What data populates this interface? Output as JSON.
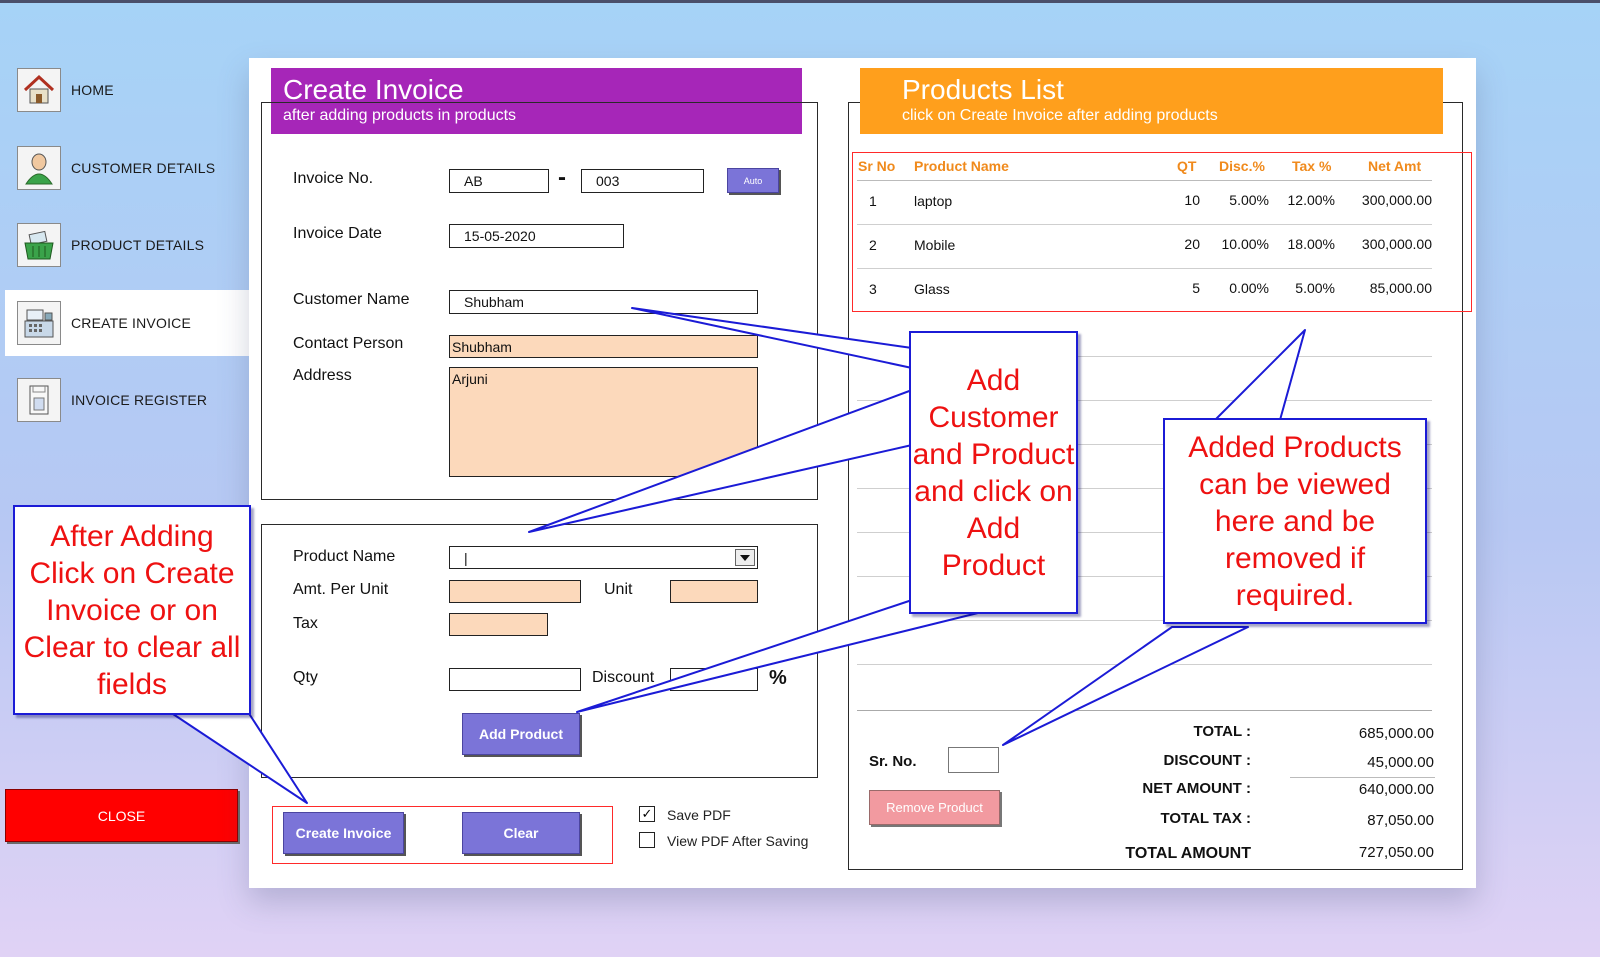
{
  "sidebar": {
    "items": [
      {
        "label": "HOME",
        "icon": "home-icon"
      },
      {
        "label": "CUSTOMER DETAILS",
        "icon": "customer-icon"
      },
      {
        "label": "PRODUCT DETAILS",
        "icon": "basket-icon"
      },
      {
        "label": "CREATE INVOICE",
        "icon": "cash-register-icon",
        "active": true
      },
      {
        "label": "INVOICE REGISTER",
        "icon": "register-icon"
      }
    ],
    "close_label": "CLOSE"
  },
  "invoice": {
    "title": "Create Invoice",
    "subtitle": "after adding products in products",
    "invoice_no_label": "Invoice No.",
    "invoice_prefix": "AB",
    "invoice_separator": "-",
    "invoice_number": "003",
    "auto_label": "Auto",
    "invoice_date_label": "Invoice Date",
    "invoice_date": "15-05-2020",
    "customer_name_label": "Customer Name",
    "customer_name": "Shubham",
    "contact_person_label": "Contact Person",
    "contact_person": "Shubham",
    "address_label": "Address",
    "address": "Arjuni"
  },
  "product_form": {
    "product_name_label": "Product Name",
    "product_name": "|",
    "amt_per_unit_label": "Amt. Per Unit",
    "unit_label": "Unit",
    "tax_label": "Tax",
    "qty_label": "Qty",
    "discount_label": "Discount",
    "percent_sign": "%",
    "add_product_label": "Add Product"
  },
  "actions": {
    "create_invoice_label": "Create Invoice",
    "clear_label": "Clear",
    "save_pdf_label": "Save PDF",
    "save_pdf_checked": true,
    "view_pdf_label": "View PDF After Saving",
    "view_pdf_checked": false,
    "save_pdf_mark": "✓"
  },
  "products": {
    "title": "Products List",
    "subtitle": "click on Create Invoice after adding products",
    "columns": [
      "Sr No",
      "Product Name",
      "QT",
      "Disc.%",
      "Tax %",
      "Net Amt"
    ],
    "rows": [
      {
        "sr": "1",
        "name": "laptop",
        "qt": "10",
        "disc": "5.00%",
        "tax": "12.00%",
        "net": "300,000.00"
      },
      {
        "sr": "2",
        "name": "Mobile",
        "qt": "20",
        "disc": "10.00%",
        "tax": "18.00%",
        "net": "300,000.00"
      },
      {
        "sr": "3",
        "name": "Glass",
        "qt": "5",
        "disc": "0.00%",
        "tax": "5.00%",
        "net": "85,000.00"
      }
    ],
    "sr_no_label": "Sr. No.",
    "remove_label": "Remove Product"
  },
  "totals": {
    "total_label": "TOTAL :",
    "total": "685,000.00",
    "discount_label": "DISCOUNT :",
    "discount": "45,000.00",
    "net_amount_label": "NET AMOUNT :",
    "net_amount": "640,000.00",
    "total_tax_label": "TOTAL TAX :",
    "total_tax": "87,050.00",
    "total_amount_label": "TOTAL AMOUNT",
    "total_amount": "727,050.00"
  },
  "callouts": {
    "add_customer": "Add Customer and Product and click on Add Product",
    "added_products": "Added Products can be viewed here and be removed if required.",
    "after_adding": "After Adding Click on Create Invoice or on Clear to clear all fields"
  },
  "colors": {
    "invoice_header": "#a626b8",
    "products_header": "#ff9f1c",
    "button": "#7b74d8",
    "close": "#ff0000",
    "peach_field": "#fcd9bb",
    "callout_text": "#ee1111",
    "callout_border": "#1b1bd6"
  }
}
